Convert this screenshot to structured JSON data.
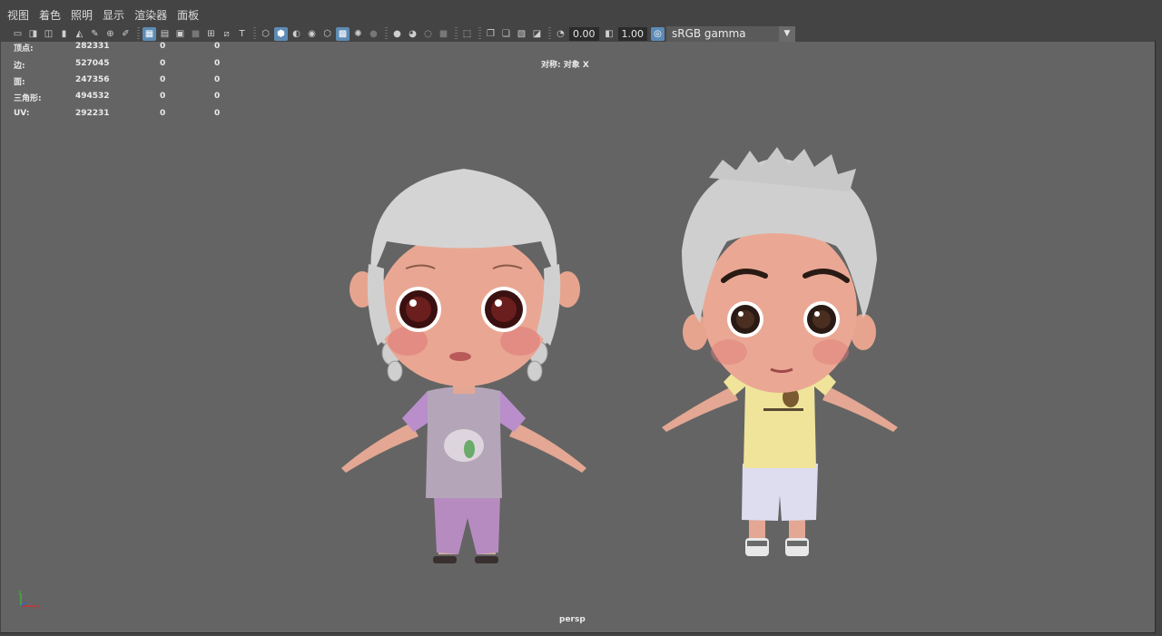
{
  "menubar": {
    "items": [
      {
        "label": "视图"
      },
      {
        "label": "着色"
      },
      {
        "label": "照明"
      },
      {
        "label": "显示"
      },
      {
        "label": "渲染器"
      },
      {
        "label": "面板"
      }
    ]
  },
  "toolbar": {
    "exposure_value": "0.00",
    "gamma_value": "1.00",
    "color_space": "sRGB gamma",
    "icons": [
      "select-camera-icon",
      "camera-attributes-icon",
      "camera-tools-icon",
      "bookmarks-icon",
      "image-plane-icon",
      "grease-pencil-icon",
      "pan-zoom-icon",
      "2d-pan-zoom-icon",
      "grid-icon",
      "film-gate-icon",
      "resolution-gate-icon",
      "gate-mask-icon",
      "field-chart-icon",
      "safe-action-icon",
      "safe-title-icon",
      "wireframe-icon",
      "smooth-shade-icon",
      "shade-wireframe-icon",
      "default-material-icon",
      "textured-icon",
      "use-lights-icon",
      "shadows-icon",
      "screen-space-ao-icon",
      "motion-blur-icon",
      "multisample-aa-icon",
      "depth-of-field-icon",
      "isolate-select-icon",
      "xray-icon",
      "xray-active-components-icon",
      "xray-joints-icon",
      "backface-culling-icon",
      "exposure-icon",
      "gamma-icon",
      "color-management-icon"
    ]
  },
  "hud": {
    "rows": [
      {
        "label": "顶点:",
        "v1": "282331",
        "v2": "0",
        "v3": "0"
      },
      {
        "label": "边:",
        "v1": "527045",
        "v2": "0",
        "v3": "0"
      },
      {
        "label": "面:",
        "v1": "247356",
        "v2": "0",
        "v3": "0"
      },
      {
        "label": "三角形:",
        "v1": "494532",
        "v2": "0",
        "v3": "0"
      },
      {
        "label": "UV:",
        "v1": "292231",
        "v2": "0",
        "v3": "0"
      }
    ],
    "symmetry": "对称: 对象 X",
    "camera": "persp"
  },
  "colors": {
    "viewport_bg": "#646464",
    "ui_bg": "#444444",
    "active_icon": "#5d8bb5",
    "axis_x": "#d03030",
    "axis_y": "#40b040",
    "axis_z": "#3060d0"
  }
}
